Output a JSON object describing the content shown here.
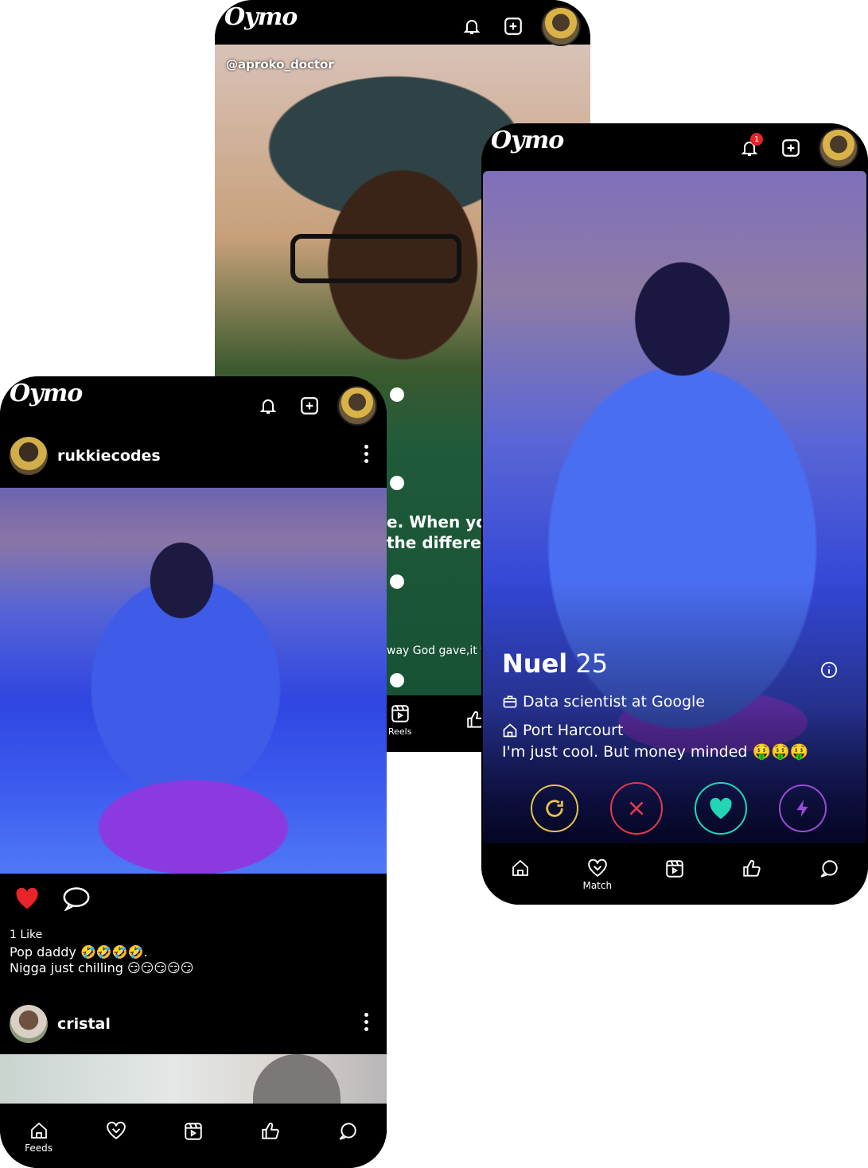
{
  "app": {
    "logo": "Oymo"
  },
  "colors": {
    "accent_like": "#e8232a",
    "match_rewind": "#e7c14a",
    "match_nope": "#e23a4d",
    "match_like": "#21d6b5",
    "match_boost": "#9b4ad8"
  },
  "reels_screen": {
    "username": "@aproko_doctor",
    "caption_line1": "e. When yo",
    "caption_line2": "the differer",
    "caption_line3": "way God gave,it t",
    "nav": {
      "reels_label": "Reels"
    }
  },
  "feed_screen": {
    "post1": {
      "username": "rukkiecodes",
      "likes": "1 Like",
      "caption_line1": "Pop daddy 🤣🤣🤣🤣.",
      "caption_line2": "Nigga just chilling 😏😏😏😏😏"
    },
    "post2": {
      "username": "cristal"
    },
    "nav": {
      "feeds_label": "Feeds"
    }
  },
  "match_screen": {
    "notification_count": "1",
    "name": "Nuel",
    "age": "25",
    "job": "Data scientist at Google",
    "location": "Port Harcourt",
    "bio": "I'm just cool. But money minded 🤑🤑🤑",
    "nav": {
      "match_label": "Match"
    }
  }
}
